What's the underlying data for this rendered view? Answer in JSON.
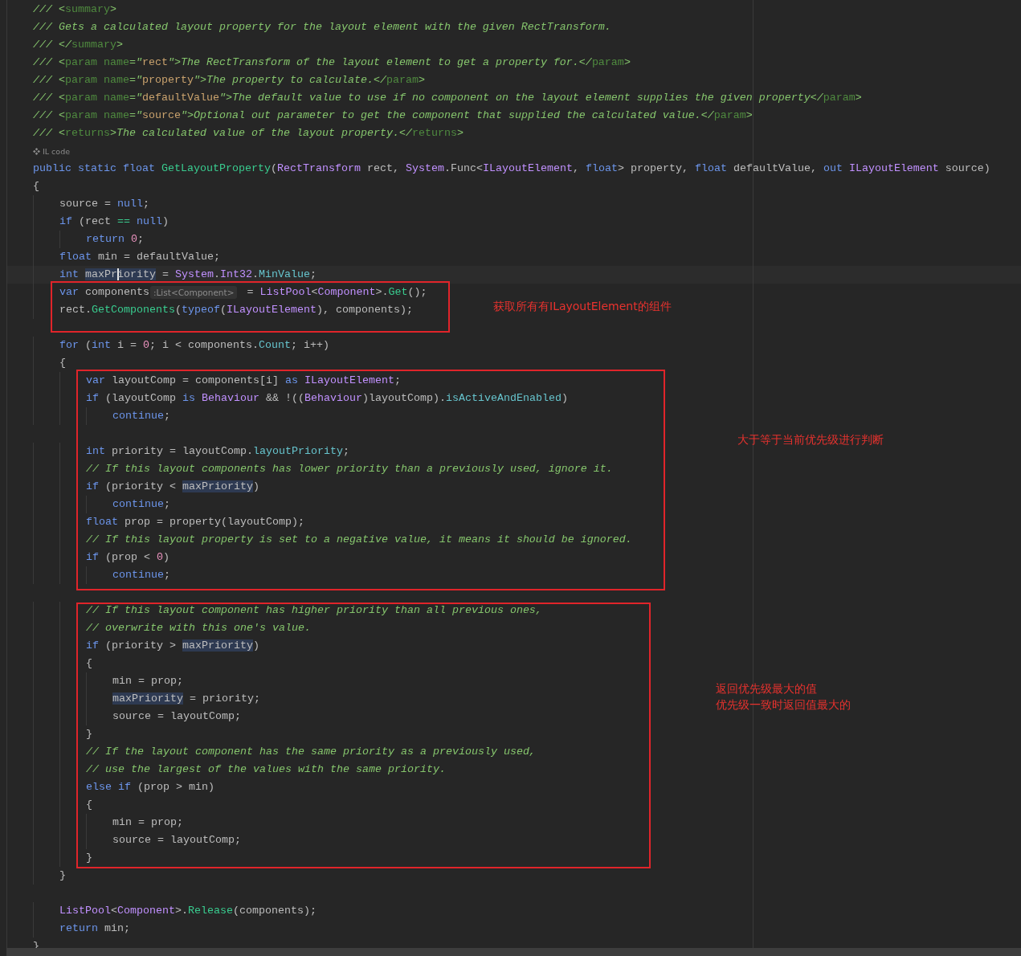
{
  "editor": {
    "lines": [
      {
        "kind": "code",
        "tokens": [
          {
            "kind": "doc",
            "s": "/// <"
          },
          {
            "kind": "doctag",
            "s": "summary"
          },
          {
            "kind": "doc",
            "s": ">"
          }
        ]
      },
      {
        "kind": "code",
        "tokens": [
          {
            "kind": "doc",
            "s": "/// Gets a calculated layout property for the layout element with the given RectTransform."
          }
        ]
      },
      {
        "kind": "code",
        "tokens": [
          {
            "kind": "doc",
            "s": "/// </"
          },
          {
            "kind": "doctag",
            "s": "summary"
          },
          {
            "kind": "doc",
            "s": ">"
          }
        ]
      },
      {
        "kind": "code",
        "tokens": [
          {
            "kind": "doc",
            "s": "/// <"
          },
          {
            "kind": "doctag",
            "s": "param name"
          },
          {
            "kind": "doc",
            "s": "=\""
          },
          {
            "kind": "docstr",
            "s": "rect"
          },
          {
            "kind": "doc",
            "s": "\">The RectTransform of the layout element to get a property for.</"
          },
          {
            "kind": "doctag",
            "s": "param"
          },
          {
            "kind": "doc",
            "s": ">"
          }
        ]
      },
      {
        "kind": "code",
        "tokens": [
          {
            "kind": "doc",
            "s": "/// <"
          },
          {
            "kind": "doctag",
            "s": "param name"
          },
          {
            "kind": "doc",
            "s": "=\""
          },
          {
            "kind": "docstr",
            "s": "property"
          },
          {
            "kind": "doc",
            "s": "\">The property to calculate.</"
          },
          {
            "kind": "doctag",
            "s": "param"
          },
          {
            "kind": "doc",
            "s": ">"
          }
        ]
      },
      {
        "kind": "code",
        "tokens": [
          {
            "kind": "doc",
            "s": "/// <"
          },
          {
            "kind": "doctag",
            "s": "param name"
          },
          {
            "kind": "doc",
            "s": "=\""
          },
          {
            "kind": "docstr",
            "s": "defaultValue"
          },
          {
            "kind": "doc",
            "s": "\">The default value to use if no component on the layout element supplies the given property</"
          },
          {
            "kind": "doctag",
            "s": "param"
          },
          {
            "kind": "doc",
            "s": ">"
          }
        ]
      },
      {
        "kind": "code",
        "tokens": [
          {
            "kind": "doc",
            "s": "/// <"
          },
          {
            "kind": "doctag",
            "s": "param name"
          },
          {
            "kind": "doc",
            "s": "=\""
          },
          {
            "kind": "docstr",
            "s": "source"
          },
          {
            "kind": "doc",
            "s": "\">Optional out parameter to get the component that supplied the calculated value.</"
          },
          {
            "kind": "doctag",
            "s": "param"
          },
          {
            "kind": "doc",
            "s": ">"
          }
        ]
      },
      {
        "kind": "code",
        "tokens": [
          {
            "kind": "doc",
            "s": "/// <"
          },
          {
            "kind": "doctag",
            "s": "returns"
          },
          {
            "kind": "doc",
            "s": ">The calculated value of the layout property.</"
          },
          {
            "kind": "doctag",
            "s": "returns"
          },
          {
            "kind": "doc",
            "s": ">"
          }
        ]
      },
      {
        "kind": "hint",
        "text": "IL code"
      },
      {
        "kind": "code",
        "tokens": [
          {
            "kind": "kw",
            "s": "public static float "
          },
          {
            "kind": "method",
            "s": "GetLayoutProperty"
          },
          {
            "kind": "plain",
            "s": "("
          },
          {
            "kind": "type",
            "s": "RectTransform"
          },
          {
            "kind": "plain",
            "s": " rect, "
          },
          {
            "kind": "type",
            "s": "System"
          },
          {
            "kind": "plain",
            "s": ".Func<"
          },
          {
            "kind": "type",
            "s": "ILayoutElement"
          },
          {
            "kind": "plain",
            "s": ", "
          },
          {
            "kind": "kw",
            "s": "float"
          },
          {
            "kind": "plain",
            "s": "> property, "
          },
          {
            "kind": "kw",
            "s": "float"
          },
          {
            "kind": "plain",
            "s": " defaultValue, "
          },
          {
            "kind": "kw",
            "s": "out "
          },
          {
            "kind": "type",
            "s": "ILayoutElement"
          },
          {
            "kind": "plain",
            "s": " source)"
          }
        ]
      },
      {
        "kind": "code",
        "tokens": [
          {
            "kind": "plain",
            "s": "{"
          }
        ]
      },
      {
        "kind": "code",
        "tokens": [
          {
            "kind": "plain",
            "s": "    source = "
          },
          {
            "kind": "kw",
            "s": "null"
          },
          {
            "kind": "plain",
            "s": ";"
          }
        ]
      },
      {
        "kind": "code",
        "tokens": [
          {
            "kind": "kw",
            "s": "    if"
          },
          {
            "kind": "plain",
            "s": " (rect "
          },
          {
            "kind": "op",
            "s": "=="
          },
          {
            "kind": "kw",
            "s": " null"
          },
          {
            "kind": "plain",
            "s": ")"
          }
        ]
      },
      {
        "kind": "code",
        "tokens": [
          {
            "kind": "kw",
            "s": "        return "
          },
          {
            "kind": "num",
            "s": "0"
          },
          {
            "kind": "plain",
            "s": ";"
          }
        ]
      },
      {
        "kind": "code",
        "tokens": [
          {
            "kind": "kw",
            "s": "    float"
          },
          {
            "kind": "plain",
            "s": " min = defaultValue;"
          }
        ]
      },
      {
        "kind": "current",
        "tokens": [
          {
            "kind": "kw",
            "s": "    int "
          },
          {
            "kind": "usage",
            "s": "maxPr"
          },
          {
            "kind": "usage_caret",
            "s": "iority"
          },
          {
            "kind": "plain",
            "s": " = "
          },
          {
            "kind": "type",
            "s": "System"
          },
          {
            "kind": "plain",
            "s": "."
          },
          {
            "kind": "type",
            "s": "Int32"
          },
          {
            "kind": "plain",
            "s": "."
          },
          {
            "kind": "prop",
            "s": "MinValue"
          },
          {
            "kind": "plain",
            "s": ";"
          }
        ]
      },
      {
        "kind": "code",
        "tokens": [
          {
            "kind": "kw",
            "s": "    var"
          },
          {
            "kind": "plain",
            "s": " components"
          },
          {
            "kind": "hint",
            "s": ":List<Component>"
          },
          {
            "kind": "plain",
            "s": " = "
          },
          {
            "kind": "type",
            "s": "ListPool"
          },
          {
            "kind": "plain",
            "s": "<"
          },
          {
            "kind": "type",
            "s": "Component"
          },
          {
            "kind": "plain",
            "s": ">."
          },
          {
            "kind": "method",
            "s": "Get"
          },
          {
            "kind": "plain",
            "s": "();"
          }
        ]
      },
      {
        "kind": "code",
        "tokens": [
          {
            "kind": "plain",
            "s": "    rect."
          },
          {
            "kind": "method",
            "s": "GetComponents"
          },
          {
            "kind": "plain",
            "s": "("
          },
          {
            "kind": "kw",
            "s": "typeof"
          },
          {
            "kind": "plain",
            "s": "("
          },
          {
            "kind": "type",
            "s": "ILayoutElement"
          },
          {
            "kind": "plain",
            "s": "), components);"
          }
        ]
      },
      {
        "kind": "blank"
      },
      {
        "kind": "code",
        "tokens": [
          {
            "kind": "kw",
            "s": "    for"
          },
          {
            "kind": "plain",
            "s": " ("
          },
          {
            "kind": "kw",
            "s": "int"
          },
          {
            "kind": "plain",
            "s": " i = "
          },
          {
            "kind": "num",
            "s": "0"
          },
          {
            "kind": "plain",
            "s": "; i < components."
          },
          {
            "kind": "prop",
            "s": "Count"
          },
          {
            "kind": "plain",
            "s": "; i++)"
          }
        ]
      },
      {
        "kind": "code",
        "tokens": [
          {
            "kind": "plain",
            "s": "    {"
          }
        ]
      },
      {
        "kind": "code",
        "tokens": [
          {
            "kind": "kw",
            "s": "        var"
          },
          {
            "kind": "plain",
            "s": " layoutComp = components[i] "
          },
          {
            "kind": "kw",
            "s": "as "
          },
          {
            "kind": "type",
            "s": "ILayoutElement"
          },
          {
            "kind": "plain",
            "s": ";"
          }
        ]
      },
      {
        "kind": "code",
        "tokens": [
          {
            "kind": "kw",
            "s": "        if"
          },
          {
            "kind": "plain",
            "s": " (layoutComp "
          },
          {
            "kind": "kw",
            "s": "is "
          },
          {
            "kind": "type",
            "s": "Behaviour"
          },
          {
            "kind": "plain",
            "s": " && !(("
          },
          {
            "kind": "type",
            "s": "Behaviour"
          },
          {
            "kind": "plain",
            "s": ")layoutComp)."
          },
          {
            "kind": "prop",
            "s": "isActiveAndEnabled"
          },
          {
            "kind": "plain",
            "s": ")"
          }
        ]
      },
      {
        "kind": "code",
        "tokens": [
          {
            "kind": "kw",
            "s": "            continue"
          },
          {
            "kind": "plain",
            "s": ";"
          }
        ]
      },
      {
        "kind": "blank"
      },
      {
        "kind": "code",
        "tokens": [
          {
            "kind": "kw",
            "s": "        int"
          },
          {
            "kind": "plain",
            "s": " priority = layoutComp."
          },
          {
            "kind": "prop",
            "s": "layoutPriority"
          },
          {
            "kind": "plain",
            "s": ";"
          }
        ]
      },
      {
        "kind": "code",
        "tokens": [
          {
            "kind": "comment",
            "s": "        // If this layout components has lower priority than a previously used, ignore it."
          }
        ]
      },
      {
        "kind": "code",
        "tokens": [
          {
            "kind": "kw",
            "s": "        if"
          },
          {
            "kind": "plain",
            "s": " (priority < "
          },
          {
            "kind": "usage",
            "s": "maxPriority"
          },
          {
            "kind": "plain",
            "s": ")"
          }
        ]
      },
      {
        "kind": "code",
        "tokens": [
          {
            "kind": "kw",
            "s": "            continue"
          },
          {
            "kind": "plain",
            "s": ";"
          }
        ]
      },
      {
        "kind": "code",
        "tokens": [
          {
            "kind": "kw",
            "s": "        float"
          },
          {
            "kind": "plain",
            "s": " prop = property(layoutComp);"
          }
        ]
      },
      {
        "kind": "code",
        "tokens": [
          {
            "kind": "comment",
            "s": "        // If this layout property is set to a negative value, it means it should be ignored."
          }
        ]
      },
      {
        "kind": "code",
        "tokens": [
          {
            "kind": "kw",
            "s": "        if"
          },
          {
            "kind": "plain",
            "s": " (prop < "
          },
          {
            "kind": "num",
            "s": "0"
          },
          {
            "kind": "plain",
            "s": ")"
          }
        ]
      },
      {
        "kind": "code",
        "tokens": [
          {
            "kind": "kw",
            "s": "            continue"
          },
          {
            "kind": "plain",
            "s": ";"
          }
        ]
      },
      {
        "kind": "blank"
      },
      {
        "kind": "code",
        "tokens": [
          {
            "kind": "comment",
            "s": "        // If this layout component has higher priority than all previous ones,"
          }
        ]
      },
      {
        "kind": "code",
        "tokens": [
          {
            "kind": "comment",
            "s": "        // overwrite with this one's value."
          }
        ]
      },
      {
        "kind": "code",
        "tokens": [
          {
            "kind": "kw",
            "s": "        if"
          },
          {
            "kind": "plain",
            "s": " (priority > "
          },
          {
            "kind": "usage",
            "s": "maxPriority"
          },
          {
            "kind": "plain",
            "s": ")"
          }
        ]
      },
      {
        "kind": "code",
        "tokens": [
          {
            "kind": "plain",
            "s": "        {"
          }
        ]
      },
      {
        "kind": "code",
        "tokens": [
          {
            "kind": "plain",
            "s": "            min = prop;"
          }
        ]
      },
      {
        "kind": "code",
        "tokens": [
          {
            "kind": "usage",
            "s": "            maxPriority"
          },
          {
            "kind": "plain",
            "s": " = priority;"
          }
        ]
      },
      {
        "kind": "code",
        "tokens": [
          {
            "kind": "plain",
            "s": "            source = layoutComp;"
          }
        ]
      },
      {
        "kind": "code",
        "tokens": [
          {
            "kind": "plain",
            "s": "        }"
          }
        ]
      },
      {
        "kind": "code",
        "tokens": [
          {
            "kind": "comment",
            "s": "        // If the layout component has the same priority as a previously used,"
          }
        ]
      },
      {
        "kind": "code",
        "tokens": [
          {
            "kind": "comment",
            "s": "        // use the largest of the values with the same priority."
          }
        ]
      },
      {
        "kind": "code",
        "tokens": [
          {
            "kind": "kw",
            "s": "        else if"
          },
          {
            "kind": "plain",
            "s": " (prop > min)"
          }
        ]
      },
      {
        "kind": "code",
        "tokens": [
          {
            "kind": "plain",
            "s": "        {"
          }
        ]
      },
      {
        "kind": "code",
        "tokens": [
          {
            "kind": "plain",
            "s": "            min = prop;"
          }
        ]
      },
      {
        "kind": "code",
        "tokens": [
          {
            "kind": "plain",
            "s": "            source = layoutComp;"
          }
        ]
      },
      {
        "kind": "code",
        "tokens": [
          {
            "kind": "plain",
            "s": "        }"
          }
        ]
      },
      {
        "kind": "code",
        "tokens": [
          {
            "kind": "plain",
            "s": "    }"
          }
        ]
      },
      {
        "kind": "blank"
      },
      {
        "kind": "code",
        "tokens": [
          {
            "kind": "type",
            "s": "    ListPool"
          },
          {
            "kind": "plain",
            "s": "<"
          },
          {
            "kind": "type",
            "s": "Component"
          },
          {
            "kind": "plain",
            "s": ">."
          },
          {
            "kind": "method",
            "s": "Release"
          },
          {
            "kind": "plain",
            "s": "(components);"
          }
        ]
      },
      {
        "kind": "code",
        "tokens": [
          {
            "kind": "kw",
            "s": "    return"
          },
          {
            "kind": "plain",
            "s": " min;"
          }
        ]
      },
      {
        "kind": "code",
        "tokens": [
          {
            "kind": "plain",
            "s": "}"
          }
        ]
      }
    ]
  },
  "annotations": [
    {
      "lines": [
        "获取所有有ILayoutElement的组件"
      ]
    },
    {
      "lines": [
        "大于等于当前优先级进行判断"
      ]
    },
    {
      "lines": [
        "返回优先级最大的值",
        "优先级一致时返回值最大的"
      ]
    }
  ]
}
